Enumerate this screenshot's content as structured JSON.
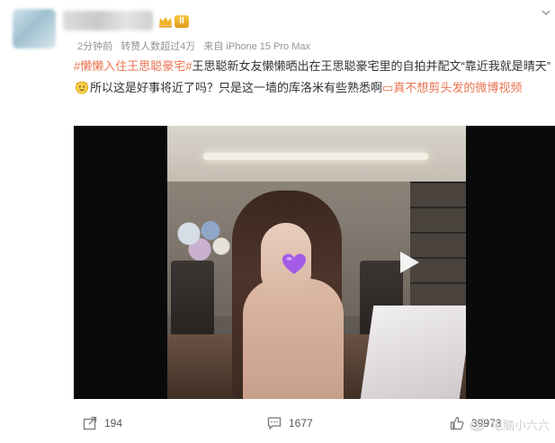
{
  "post": {
    "meta": {
      "time": "2分钟前",
      "reposts": "转赞人数超过4万",
      "source": "来自 iPhone 15 Pro Max"
    },
    "badge": {
      "level": "II"
    },
    "content": {
      "topic": "#懒懒入住王思聪豪宅#",
      "text_1": "王思聪新女友懒懒晒出在王思聪豪宅里的自拍并配文“靠近我就是晴天”",
      "text_2": "所以这是好事将近了吗？只是这一墙的库洛米有些熟悉啊",
      "video_link": "真不想剪头发的微博视频",
      "video_link_icon": "▭"
    },
    "video": {
      "play_icon": "play-icon",
      "sticker_icon": "purple-heart-icon"
    },
    "actions": {
      "repost_count": "194",
      "comment_count": "1677",
      "like_count": "39973"
    },
    "watermark": {
      "text": "电脑小六六"
    }
  },
  "colors": {
    "accent": "#eb7350",
    "meta_text": "#939393",
    "body_text": "#333333"
  }
}
